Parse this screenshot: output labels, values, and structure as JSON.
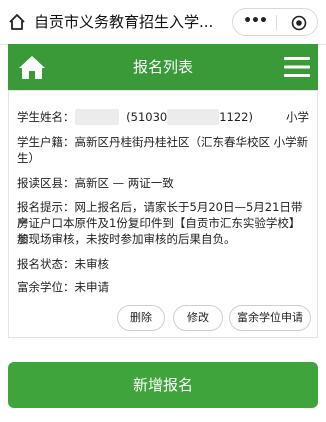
{
  "window": {
    "title": "自贡市义务教育招生入学...",
    "more_label": "•••"
  },
  "header": {
    "title": "报名列表"
  },
  "card": {
    "student_name_label": "学生姓名：",
    "student_id_open": "(51030",
    "student_id_close": "1122)",
    "school_type": "小学",
    "household_line1": "学生户籍：高新区丹桂街丹桂社区（汇东春华校区 小学新",
    "household_line2": "生）",
    "district": "报读区县：高新区 — 两证一致",
    "notice_line1": "报名提示：网上报名后，请家长于5月20日—5月21日带房",
    "notice_line2": "产证户口本原件及1份复印件到【自贡市汇东实验学校】参",
    "notice_line3": "加现场审核，未按时参加审核的后果自负。",
    "status": "报名状态：未审核",
    "surplus": "富余学位：未申请"
  },
  "actions": {
    "delete": "删除",
    "edit": "修改",
    "apply_surplus": "富余学位申请"
  },
  "footer": {
    "add_label": "新增报名"
  },
  "colors": {
    "brand_green": "#3a9a38",
    "button_green": "#3fa43b"
  },
  "icons": [
    "home-outline-icon",
    "more-dots-icon",
    "target-close-icon",
    "house-icon",
    "menu-icon"
  ]
}
